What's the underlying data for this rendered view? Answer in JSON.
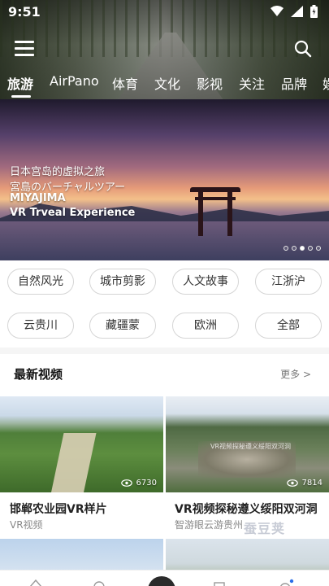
{
  "status": {
    "time": "9:51"
  },
  "tabs": [
    "旅游",
    "AirPano",
    "体育",
    "文化",
    "影视",
    "关注",
    "品牌",
    "娱"
  ],
  "banner": {
    "line1": "日本宫岛的虚拟之旅",
    "line2": "宮島のバーチャルツアー",
    "line3": "MIYAJIMA",
    "line4": "VR Trveal Experience",
    "page_count": 5,
    "active_page": 3
  },
  "categories": [
    "自然风光",
    "城市剪影",
    "人文故事",
    "江浙沪",
    "云贵川",
    "藏疆蒙",
    "欧洲",
    "全部"
  ],
  "latest": {
    "title": "最新视频",
    "more": "更多 >",
    "videos": [
      {
        "title": "邯郸农业园VR样片",
        "source": "VR视频",
        "views": "6730"
      },
      {
        "title": "VR视频探秘遵义绥阳双河洞",
        "source": "智游眼云游贵州",
        "views": "7814",
        "thumb_text": "VR视频探秘遵义绥阳双河洞"
      }
    ]
  },
  "watermark": "蚕豆荚",
  "colors": {
    "text": "#222222",
    "muted": "#888888",
    "chip_border": "#d5d5d5",
    "background": "#ffffff"
  }
}
